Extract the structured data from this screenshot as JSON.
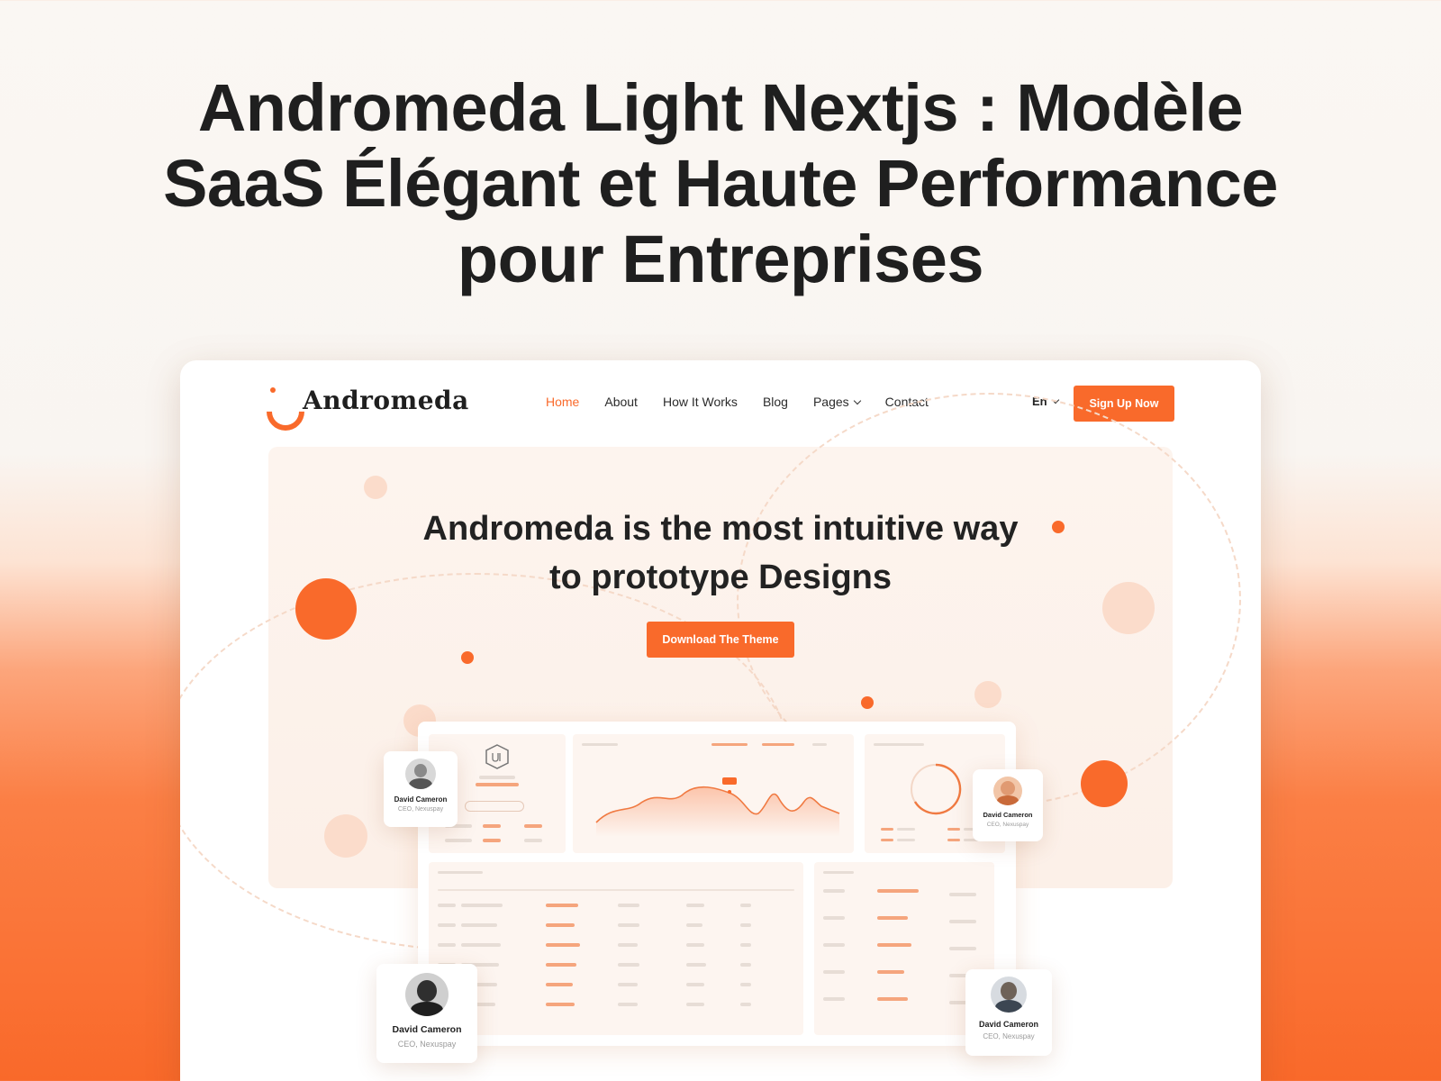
{
  "page": {
    "title_lines": [
      "Andromeda Light Nextjs : Modèle",
      "SaaS Élégant et Haute Performance",
      "pour Entreprises"
    ]
  },
  "site": {
    "logo_text": "Andromeda",
    "nav": [
      "Home",
      "About",
      "How It Works",
      "Blog",
      "Pages",
      "Contact"
    ],
    "language": "En",
    "signup_label": "Sign Up Now",
    "hero_lines": [
      "Andromeda is the most intuitive way",
      "to prototype Designs"
    ],
    "download_label": "Download The Theme"
  },
  "profiles": [
    {
      "name": "David Cameron",
      "role": "CEO, Nexuspay"
    },
    {
      "name": "David Cameron",
      "role": "CEO, Nexuspay"
    },
    {
      "name": "David Cameron",
      "role": "CEO, Nexuspay"
    },
    {
      "name": "David Cameron",
      "role": "CEO, Nexuspay"
    }
  ],
  "colors": {
    "accent": "#f96a2b",
    "text_dark": "#1f1f1f"
  }
}
